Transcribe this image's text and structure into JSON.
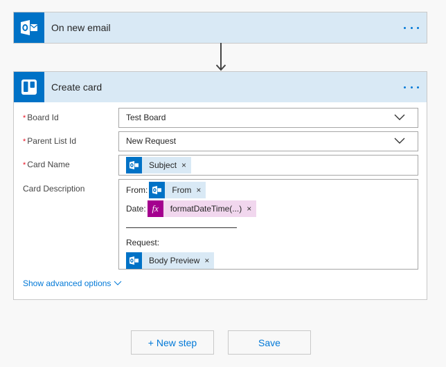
{
  "trigger": {
    "title": "On new email",
    "icon": "outlook-icon",
    "accent": "#0072c6"
  },
  "action": {
    "title": "Create card",
    "icon": "trello-icon",
    "accent": "#0072c6",
    "fields": {
      "board_id": {
        "label": "Board Id",
        "required": "*",
        "value": "Test Board"
      },
      "parent_list_id": {
        "label": "Parent List Id",
        "required": "*",
        "value": "New Request"
      },
      "card_name": {
        "label": "Card Name",
        "required": "*",
        "tokens": [
          {
            "label": "Subject",
            "icon": "outlook-icon",
            "close": "×"
          }
        ]
      },
      "card_description": {
        "label": "Card Description",
        "lines": {
          "from_prefix": "From:",
          "from_token": {
            "label": "From",
            "icon": "outlook-icon",
            "close": "×"
          },
          "date_prefix": "Date:",
          "date_token": {
            "label": "formatDateTime(...)",
            "icon": "fx-icon",
            "icon_text": "fx",
            "close": "×"
          },
          "request_label": "Request:",
          "body_token": {
            "label": "Body Preview",
            "icon": "outlook-icon",
            "close": "×"
          }
        }
      }
    },
    "advanced_label": "Show advanced options"
  },
  "buttons": {
    "new_step": "+ New step",
    "save": "Save"
  },
  "colors": {
    "header_bg": "#d9e9f5",
    "link": "#0078d7",
    "fx_token": "#a4008f",
    "required": "#e81123"
  }
}
